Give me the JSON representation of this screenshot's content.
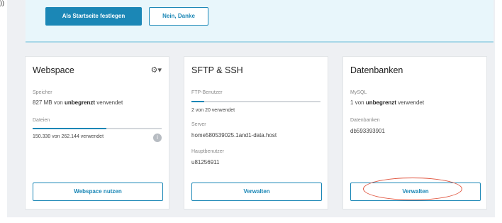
{
  "corner_text": "))",
  "banner": {
    "primary_label": "Als Startseite festlegen",
    "secondary_label": "Nein, Danke"
  },
  "webspace": {
    "title": "Webspace",
    "gear_icon": "gear-dropdown-icon",
    "storage_label": "Speicher",
    "storage_used": "827 MB",
    "storage_von": "von",
    "storage_limit": "unbegrenzt",
    "storage_suffix": "verwendet",
    "files_label": "Dateien",
    "files_value": "150.330 von 262.144 verwendet",
    "files_progress": 0.57,
    "info_icon": "info-icon",
    "button_label": "Webspace nutzen"
  },
  "sftp": {
    "title": "SFTP & SSH",
    "users_label": "FTP-Benutzer",
    "users_value": "2 von 20 verwendet",
    "users_progress": 0.1,
    "server_label": "Server",
    "server_value": "home580539025.1and1-data.host",
    "main_user_label": "Hauptbenutzer",
    "main_user_value": "u81256911",
    "button_label": "Verwalten"
  },
  "databases": {
    "title": "Datenbanken",
    "mysql_label": "MySQL",
    "mysql_count": "1",
    "mysql_von": "von",
    "mysql_limit": "unbegrenzt",
    "mysql_suffix": "verwendet",
    "db_label": "Datenbanken",
    "db_value": "db593393901",
    "button_label": "Verwalten"
  },
  "colors": {
    "accent": "#1b87b6",
    "highlight": "#e0533d",
    "banner_bg": "#e8f6fb"
  }
}
